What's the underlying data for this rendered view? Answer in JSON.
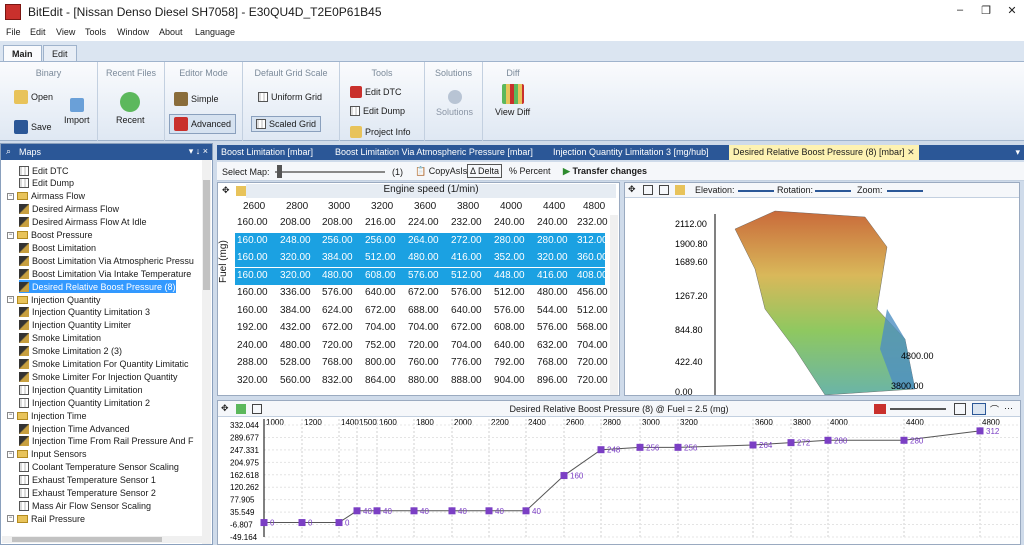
{
  "window": {
    "title": "BitEdit - [Nissan Denso Diesel SH7058] - E30QU4D_T2E0P61B45"
  },
  "menu": [
    "File",
    "Edit",
    "View",
    "Tools",
    "Window",
    "About",
    "Language"
  ],
  "ribbon_tabs": [
    "Main",
    "Edit"
  ],
  "ribbon": {
    "binary": {
      "title": "Binary",
      "open": "Open",
      "save": "Save",
      "import": "Import"
    },
    "recent": {
      "title": "Recent Files",
      "recent": "Recent"
    },
    "editor_mode": {
      "title": "Editor Mode",
      "simple": "Simple",
      "advanced": "Advanced"
    },
    "grid_scale": {
      "title": "Default Grid Scale",
      "uniform": "Uniform Grid",
      "scaled": "Scaled Grid"
    },
    "tools": {
      "title": "Tools",
      "edit_dtc": "Edit DTC",
      "edit_dump": "Edit Dump",
      "project_info": "Project Info"
    },
    "solutions": {
      "title": "Solutions",
      "solutions": "Solutions"
    },
    "diff": {
      "title": "Diff",
      "view_diff": "View Diff"
    }
  },
  "maps_panel": {
    "title": "Maps",
    "pin": "▾ ↓ ×",
    "items": [
      {
        "label": "Edit DTC",
        "type": "tool",
        "indent": 1
      },
      {
        "label": "Edit Dump",
        "type": "tool",
        "indent": 1
      },
      {
        "label": "Airmass Flow",
        "type": "folder",
        "indent": 0
      },
      {
        "label": "Desired Airmass Flow",
        "type": "map",
        "indent": 1
      },
      {
        "label": "Desired Airmass Flow At Idle",
        "type": "map",
        "indent": 1
      },
      {
        "label": "Boost Pressure",
        "type": "folder",
        "indent": 0
      },
      {
        "label": "Boost Limitation",
        "type": "map",
        "indent": 1
      },
      {
        "label": "Boost Limitation Via Atmospheric Pressu",
        "type": "map",
        "indent": 1
      },
      {
        "label": "Boost Limitation Via Intake Temperature",
        "type": "map",
        "indent": 1
      },
      {
        "label": "Desired Relative Boost Pressure (8)",
        "type": "map",
        "indent": 1,
        "selected": true
      },
      {
        "label": "Injection Quantity",
        "type": "folder",
        "indent": 0
      },
      {
        "label": "Injection Quantity Limitation 3",
        "type": "map",
        "indent": 1
      },
      {
        "label": "Injection Quantity Limiter",
        "type": "map",
        "indent": 1
      },
      {
        "label": "Smoke Limitation",
        "type": "map",
        "indent": 1
      },
      {
        "label": "Smoke Limitation 2 (3)",
        "type": "map",
        "indent": 1
      },
      {
        "label": "Smoke Limitation For Quantity Limitatic",
        "type": "map",
        "indent": 1
      },
      {
        "label": "Smoke Limiter For Injection Quantity",
        "type": "map",
        "indent": 1
      },
      {
        "label": "Injection Quantity Limitation",
        "type": "grid",
        "indent": 1
      },
      {
        "label": "Injection Quantity Limitation 2",
        "type": "grid",
        "indent": 1
      },
      {
        "label": "Injection Time",
        "type": "folder",
        "indent": 0
      },
      {
        "label": "Injection Time Advanced",
        "type": "map",
        "indent": 1
      },
      {
        "label": "Injection Time From Rail Pressure And F",
        "type": "map",
        "indent": 1
      },
      {
        "label": "Input Sensors",
        "type": "folder",
        "indent": 0
      },
      {
        "label": "Coolant Temperature Sensor Scaling",
        "type": "grid",
        "indent": 1
      },
      {
        "label": "Exhaust Temperature Sensor 1",
        "type": "grid",
        "indent": 1
      },
      {
        "label": "Exhaust Temperature Sensor 2",
        "type": "grid",
        "indent": 1
      },
      {
        "label": "Mass Air Flow Sensor Scaling",
        "type": "grid",
        "indent": 1
      },
      {
        "label": "Rail Pressure",
        "type": "folder",
        "indent": 0
      }
    ]
  },
  "doc_tabs": [
    "Boost Limitation [mbar]",
    "Boost Limitation Via Atmospheric Pressure [mbar]",
    "Injection Quantity Limitation 3 [mg/hub]",
    "Desired Relative Boost Pressure (8) [mbar]"
  ],
  "toolbar": {
    "select_map": "Select Map:",
    "map_index": "(1)",
    "copy": "CopyAsIs",
    "delta": "Delta",
    "percent": "Percent",
    "transfer": "Transfer changes"
  },
  "table": {
    "x_title": "Engine speed (1/min)",
    "y_title": "Fuel (mg)",
    "cols": [
      "2600",
      "2800",
      "3000",
      "3200",
      "3600",
      "3800",
      "4000",
      "4400",
      "4800"
    ],
    "rows": [
      [
        "160.00",
        "208.00",
        "208.00",
        "216.00",
        "224.00",
        "232.00",
        "240.00",
        "240.00",
        "232.00"
      ],
      [
        "160.00",
        "248.00",
        "256.00",
        "256.00",
        "264.00",
        "272.00",
        "280.00",
        "280.00",
        "312.00"
      ],
      [
        "160.00",
        "320.00",
        "384.00",
        "512.00",
        "480.00",
        "416.00",
        "352.00",
        "320.00",
        "360.00"
      ],
      [
        "160.00",
        "320.00",
        "480.00",
        "608.00",
        "576.00",
        "512.00",
        "448.00",
        "416.00",
        "408.00"
      ],
      [
        "160.00",
        "336.00",
        "576.00",
        "640.00",
        "672.00",
        "576.00",
        "512.00",
        "480.00",
        "456.00"
      ],
      [
        "160.00",
        "384.00",
        "624.00",
        "672.00",
        "688.00",
        "640.00",
        "576.00",
        "544.00",
        "512.00"
      ],
      [
        "192.00",
        "432.00",
        "672.00",
        "704.00",
        "704.00",
        "672.00",
        "608.00",
        "576.00",
        "568.00"
      ],
      [
        "240.00",
        "480.00",
        "720.00",
        "752.00",
        "720.00",
        "704.00",
        "640.00",
        "632.00",
        "704.00"
      ],
      [
        "288.00",
        "528.00",
        "768.00",
        "800.00",
        "760.00",
        "776.00",
        "792.00",
        "768.00",
        "720.00"
      ],
      [
        "320.00",
        "560.00",
        "832.00",
        "864.00",
        "880.00",
        "888.00",
        "904.00",
        "896.00",
        "720.00"
      ]
    ]
  },
  "view3d": {
    "elevation": "Elevation:",
    "rotation": "Rotation:",
    "zoom": "Zoom:",
    "z_ticks": [
      "2112.00",
      "1900.80",
      "1689.60",
      "1267.20",
      "844.80",
      "422.40",
      "0.00"
    ],
    "x_ticks": [
      "4800.00",
      "3800.00"
    ]
  },
  "line_chart": {
    "title": "Desired Relative Boost Pressure (8) @ Fuel = 2.5 (mg)"
  },
  "chart_data": {
    "type": "line",
    "title": "Desired Relative Boost Pressure (8) @ Fuel = 2.5 (mg)",
    "x_ticks": [
      "1000",
      "1200",
      "1400",
      "1500",
      "1600",
      "1800",
      "2000",
      "2200",
      "2400",
      "2600",
      "2800",
      "3000",
      "3200",
      "3600",
      "3800",
      "4000",
      "4400",
      "4800"
    ],
    "y_ticks": [
      "332.044",
      "289.677",
      "247.331",
      "204.975",
      "162.618",
      "120.262",
      "77.905",
      "35.549",
      "-6.807",
      "-49.164"
    ],
    "ylim": [
      -49.164,
      332.044
    ],
    "x": [
      1000,
      1200,
      1400,
      1500,
      1600,
      1800,
      2000,
      2200,
      2400,
      2600,
      2800,
      3000,
      3200,
      3600,
      3800,
      4000,
      4400,
      4800
    ],
    "values": [
      0,
      0,
      0,
      40,
      40,
      40,
      40,
      40,
      40,
      160,
      248,
      256,
      256,
      264,
      272,
      280,
      280,
      312
    ],
    "labels": [
      "0",
      "0",
      "0",
      "40",
      "40",
      "40",
      "40",
      "40",
      "40",
      "160",
      "248",
      "256",
      "256",
      "264",
      "272",
      "280",
      "280",
      "312"
    ],
    "color": "#7b3fc4"
  }
}
